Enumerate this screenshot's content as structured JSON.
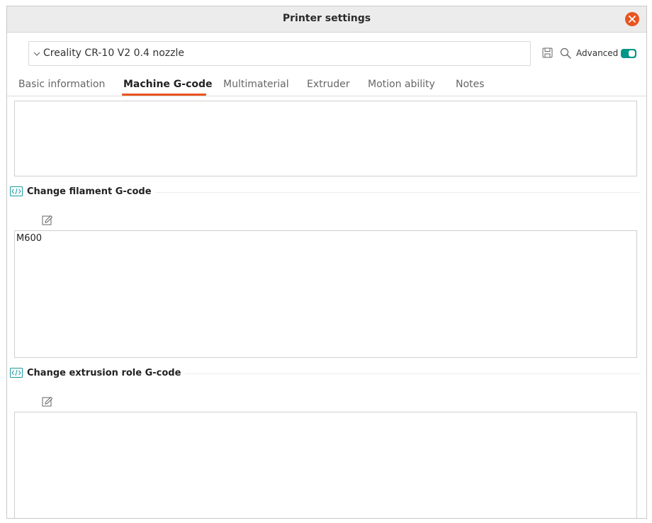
{
  "window": {
    "title": "Printer settings"
  },
  "icons": {
    "close": "close-icon",
    "chevron": "chevron-down-icon",
    "save": "save-icon",
    "search": "search-icon",
    "code": "code-icon",
    "edit": "edit-icon"
  },
  "toolbar": {
    "preset": "Creality CR-10 V2 0.4 nozzle",
    "advanced_label": "Advanced",
    "advanced_on": true
  },
  "tabs": [
    {
      "label": "Basic information",
      "active": false
    },
    {
      "label": "Machine G-code",
      "active": true
    },
    {
      "label": "Multimaterial",
      "active": false
    },
    {
      "label": "Extruder",
      "active": false
    },
    {
      "label": "Motion ability",
      "active": false
    },
    {
      "label": "Notes",
      "active": false
    }
  ],
  "sections": [
    {
      "title": "Change filament G-code",
      "value": "M600"
    },
    {
      "title": "Change extrusion role G-code",
      "value": ""
    }
  ],
  "previous_section": {
    "value": ""
  },
  "colors": {
    "accent": "#e95420",
    "toggle": "#009688",
    "code_icon": "#1b9aa0"
  }
}
